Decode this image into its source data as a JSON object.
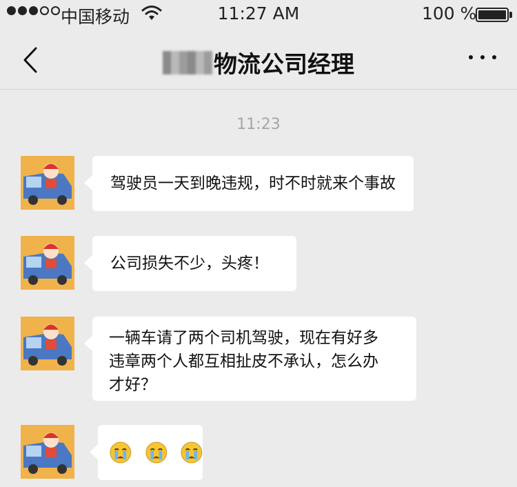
{
  "status_bar": {
    "carrier": "中国移动",
    "time": "11:27 AM",
    "battery": "100 %",
    "signal_bars_filled": 3,
    "signal_bars_total": 5
  },
  "nav": {
    "title": "物流公司经理",
    "back_icon": "chevron-left-icon",
    "more_icon": "more-horizontal-icon"
  },
  "chat": {
    "timestamp": "11:23",
    "messages": [
      {
        "text": "驾驶员一天到晚违规，时不时就来个事故"
      },
      {
        "text": "公司损失不少，头疼！"
      },
      {
        "lines": [
          "一辆车请了两个司机驾驶，现在有好多",
          "违章两个人都互相扯皮不承认，怎么办",
          "才好？"
        ]
      },
      {
        "emoji": [
          "crying-face-icon",
          "crying-face-icon",
          "crying-face-icon"
        ]
      }
    ]
  },
  "colors": {
    "background": "#ebebeb",
    "bubble": "#ffffff",
    "avatar": "#f0b24a"
  }
}
